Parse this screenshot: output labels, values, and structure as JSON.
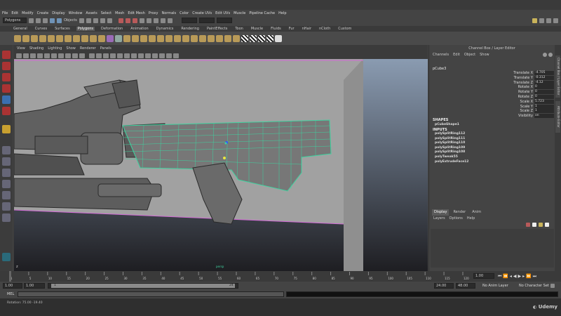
{
  "menubar": [
    "File",
    "Edit",
    "Modify",
    "Create",
    "Display",
    "Window",
    "Assets",
    "Select",
    "Mesh",
    "Edit Mesh",
    "Proxy",
    "Normals",
    "Color",
    "Create UVs",
    "Edit UVs",
    "Muscle",
    "Pipeline Cache",
    "Help"
  ],
  "status": {
    "mode": "Polygons",
    "objects_label": "Objects"
  },
  "shelf_tabs": [
    "General",
    "Curves",
    "Surfaces",
    "Polygons",
    "Deformation",
    "Animation",
    "Dynamics",
    "Rendering",
    "PaintEffects",
    "Toon",
    "Muscle",
    "Fluids",
    "Fur",
    "nHair",
    "nCloth",
    "Custom"
  ],
  "shelf_active": "Polygons",
  "viewport_menu": [
    "View",
    "Shading",
    "Lighting",
    "Show",
    "Renderer",
    "Panels"
  ],
  "channel_box": {
    "title": "Channel Box / Layer Editor",
    "menu": [
      "Channels",
      "Edit",
      "Object",
      "Show"
    ],
    "object": "pCube3",
    "attributes": [
      {
        "label": "Translate X",
        "value": "-4.705"
      },
      {
        "label": "Translate Y",
        "value": "-0.312"
      },
      {
        "label": "Translate Z",
        "value": "-4.12"
      },
      {
        "label": "Rotate X",
        "value": "0"
      },
      {
        "label": "Rotate Y",
        "value": "0"
      },
      {
        "label": "Rotate Z",
        "value": "0"
      },
      {
        "label": "Scale X",
        "value": "5.723"
      },
      {
        "label": "Scale Y",
        "value": "1"
      },
      {
        "label": "Scale Z",
        "value": "1"
      },
      {
        "label": "Visibility",
        "value": "on"
      }
    ],
    "shapes_header": "SHAPES",
    "shape": "pCubeShape1",
    "inputs_header": "INPUTS",
    "inputs": [
      "polySplitRing112",
      "polySplitRing111",
      "polySplitRing110",
      "polySplitRing109",
      "polySplitRing108",
      "polyTweak55",
      "polyExtrudeFace12"
    ]
  },
  "layer_editor": {
    "tabs": [
      "Display",
      "Render",
      "Anim"
    ],
    "active_tab": "Display",
    "menu": [
      "Layers",
      "Options",
      "Help"
    ]
  },
  "side_tabs": [
    "Channel Box / Layer Editor",
    "Attribute Editor"
  ],
  "timeline": {
    "ticks": [
      "1",
      "5",
      "10",
      "15",
      "20",
      "25",
      "30",
      "35",
      "40",
      "45",
      "50",
      "55",
      "60",
      "65",
      "70",
      "75",
      "80",
      "85",
      "90",
      "95",
      "100",
      "105",
      "110",
      "115",
      "120"
    ],
    "current": "1.00"
  },
  "range": {
    "start": "1.00",
    "inner_start": "1.00",
    "slider_start": "1",
    "slider_end": "24",
    "end": "24.00",
    "outer_end": "48.00",
    "anim_layer": "No Anim Layer",
    "character_set": "No Character Set"
  },
  "mel_label": "MEL",
  "help_line": "Rotation: 75.00 -19.40",
  "watermark": "Udemy",
  "colors": {
    "wireframe": "#3fd3a0",
    "selection": "#d46bd8",
    "accent_blue": "#6f93b7"
  }
}
